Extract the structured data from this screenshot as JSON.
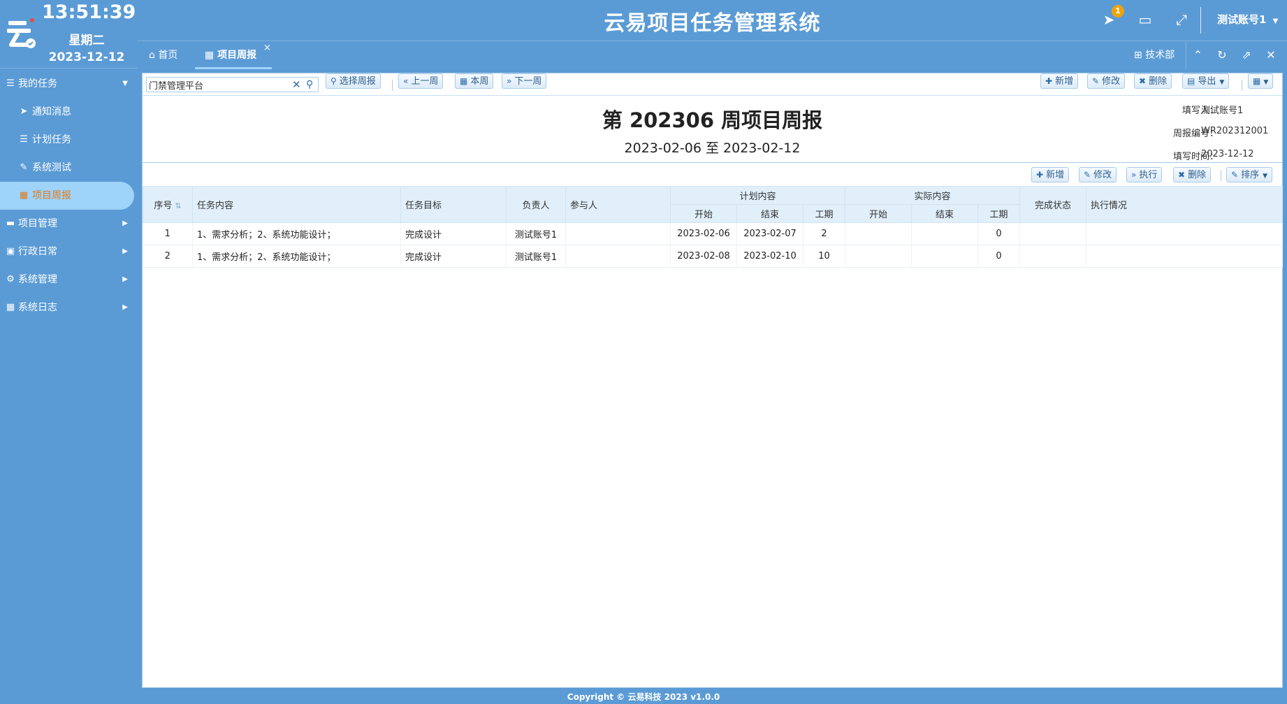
{
  "sidebar": {
    "time": "13:51:39",
    "weekday": "星期二",
    "date": "2023-12-12",
    "menu": [
      {
        "label": "我的任务",
        "icon": "list-icon",
        "expanded": true
      },
      {
        "label": "通知消息",
        "icon": "paper-plane-icon"
      },
      {
        "label": "计划任务",
        "icon": "list-icon"
      },
      {
        "label": "系统测试",
        "icon": "pencil-icon"
      },
      {
        "label": "项目周报",
        "icon": "calendar-icon",
        "active": true
      },
      {
        "label": "项目管理",
        "icon": "folder-icon"
      },
      {
        "label": "行政日常",
        "icon": "contact-card-icon"
      },
      {
        "label": "系统管理",
        "icon": "cogs-icon"
      },
      {
        "label": "系统日志",
        "icon": "calendar-icon"
      }
    ]
  },
  "header": {
    "title": "云易项目任务管理系统",
    "notification_count": "1",
    "user": "测试账号1"
  },
  "tabs": {
    "home": "首页",
    "active": "项目周报",
    "close": "×",
    "department": "技术部"
  },
  "toolbar": {
    "search_value": "门禁管理平台",
    "select_report": "选择周报",
    "prev_week": "上一周",
    "this_week": "本周",
    "next_week": "下一周",
    "add": "新增",
    "edit": "修改",
    "delete": "删除",
    "export": "导出"
  },
  "report": {
    "title": "第 202306 周项目周报",
    "range": "2023-02-06 至 2023-02-12",
    "writer_label": "填写人：",
    "writer": "测试账号1",
    "code_label": "周报编号：",
    "code": "WR202312001",
    "time_label": "填写时间：",
    "time": "2023-12-12"
  },
  "grid_toolbar": {
    "add": "新增",
    "edit": "修改",
    "execute": "执行",
    "delete": "删除",
    "sort": "排序"
  },
  "table": {
    "headers": {
      "seq": "序号",
      "content": "任务内容",
      "goal": "任务目标",
      "owner": "负责人",
      "participants": "参与人",
      "plan": "计划内容",
      "actual": "实际内容",
      "start": "开始",
      "end": "结束",
      "duration": "工期",
      "status": "完成状态",
      "execution": "执行情况"
    },
    "rows": [
      {
        "seq": "1",
        "content": "1、需求分析；2、系统功能设计；",
        "goal": "完成设计",
        "owner": "测试账号1",
        "participants": "",
        "plan_start": "2023-02-06",
        "plan_end": "2023-02-07",
        "plan_days": "2",
        "actual_start": "",
        "actual_end": "",
        "actual_days": "0",
        "status": "",
        "execution": ""
      },
      {
        "seq": "2",
        "content": "1、需求分析；2、系统功能设计；",
        "goal": "完成设计",
        "owner": "测试账号1",
        "participants": "",
        "plan_start": "2023-02-08",
        "plan_end": "2023-02-10",
        "plan_days": "10",
        "actual_start": "",
        "actual_end": "",
        "actual_days": "0",
        "status": "",
        "execution": ""
      }
    ]
  },
  "footer": "Copyright © 云易科技 2023 v1.0.0"
}
